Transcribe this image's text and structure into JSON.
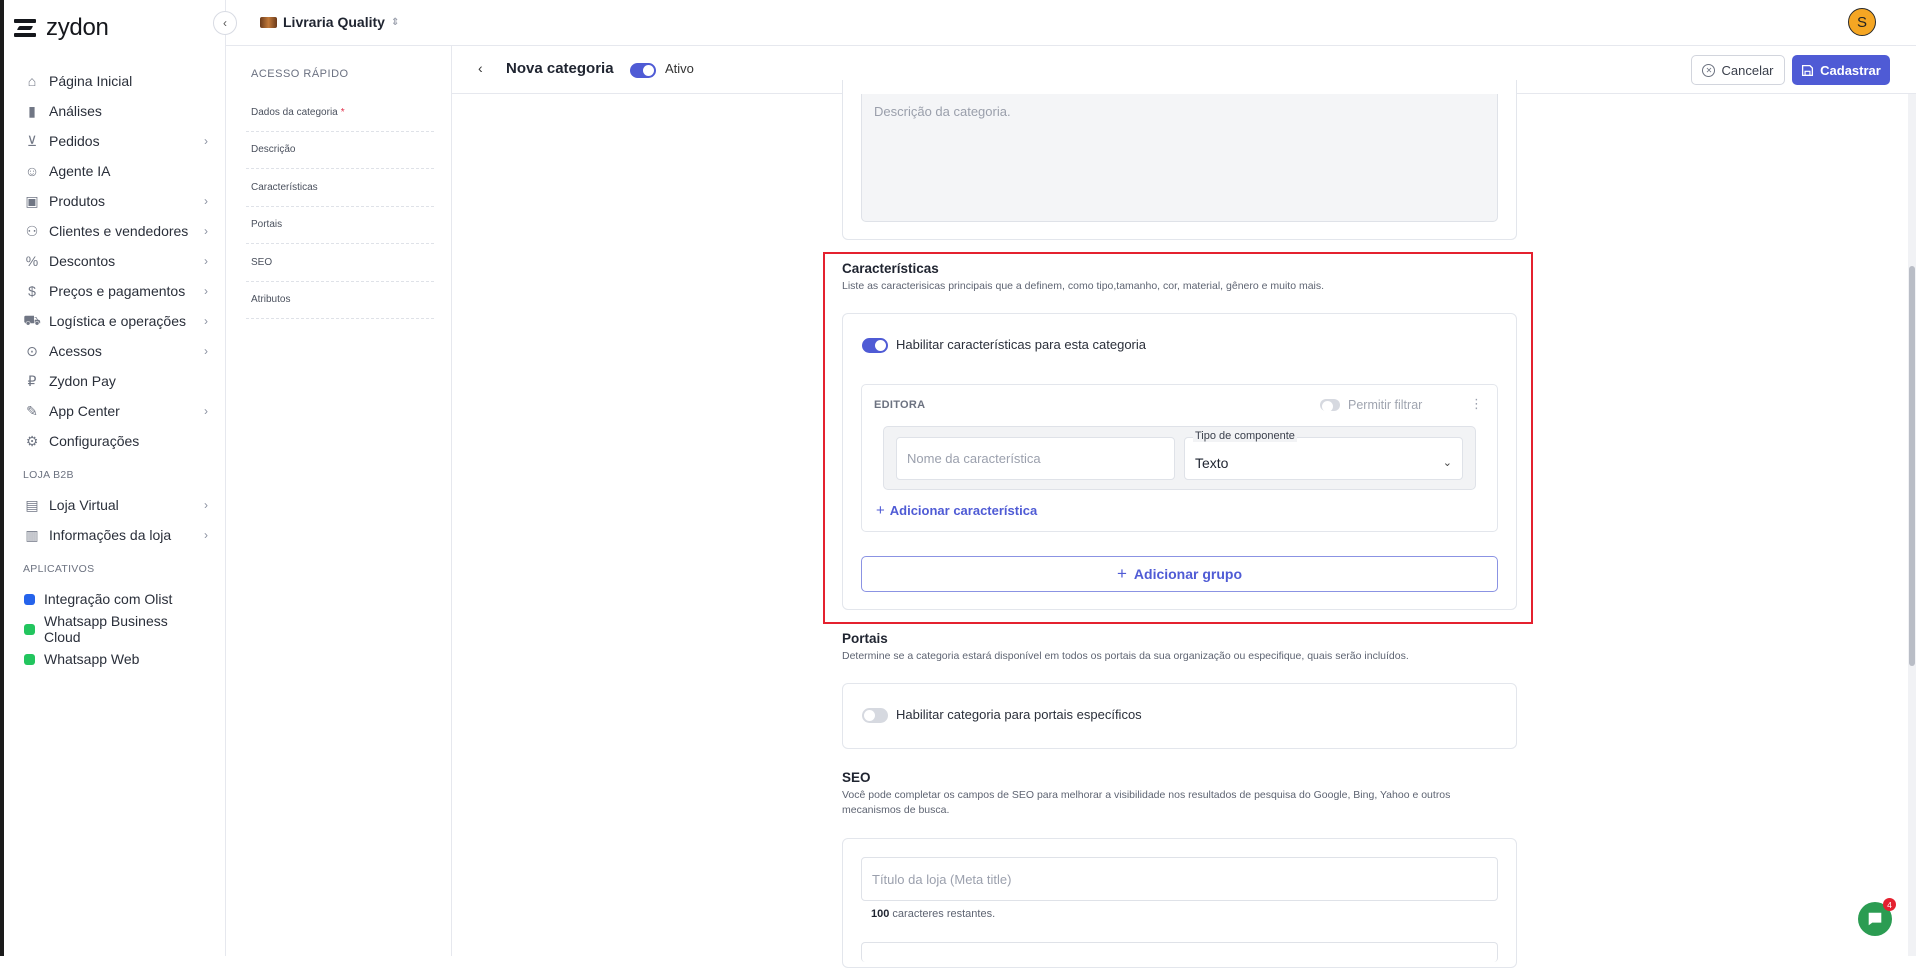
{
  "app": {
    "name": "zydon",
    "store_name": "Livraria Quality",
    "avatar_initial": "S"
  },
  "sidebar": {
    "items": [
      {
        "label": "Página Inicial",
        "icon": "home-icon"
      },
      {
        "label": "Análises",
        "icon": "bar-chart-icon"
      },
      {
        "label": "Pedidos",
        "icon": "cart-icon",
        "chevron": "›"
      },
      {
        "label": "Agente IA",
        "icon": "robot-icon"
      },
      {
        "label": "Produtos",
        "icon": "box-icon",
        "chevron": "›"
      },
      {
        "label": "Clientes e vendedores",
        "icon": "users-icon",
        "chevron": "›"
      },
      {
        "label": "Descontos",
        "icon": "percent-icon",
        "chevron": "›"
      },
      {
        "label": "Preços e pagamentos",
        "icon": "dollar-icon",
        "chevron": "›"
      },
      {
        "label": "Logística e operações",
        "icon": "truck-icon",
        "chevron": "›"
      },
      {
        "label": "Acessos",
        "icon": "lock-icon",
        "chevron": "›"
      },
      {
        "label": "Zydon Pay",
        "icon": "pay-icon"
      },
      {
        "label": "App Center",
        "icon": "puzzle-icon",
        "chevron": "›"
      },
      {
        "label": "Configurações",
        "icon": "gear-icon"
      }
    ],
    "section_b2b": "LOJA B2B",
    "b2b_items": [
      {
        "label": "Loja Virtual",
        "icon": "store-icon",
        "chevron": "›"
      },
      {
        "label": "Informações da loja",
        "icon": "info-card-icon",
        "chevron": "›"
      }
    ],
    "section_apps": "APLICATIVOS",
    "apps": [
      {
        "label": "Integração com Olist",
        "color": "#2563eb"
      },
      {
        "label": "Whatsapp Business Cloud",
        "color": "#22c55e"
      },
      {
        "label": "Whatsapp Web",
        "color": "#22c55e"
      }
    ]
  },
  "quick_access": {
    "title": "ACESSO RÁPIDO",
    "items": [
      {
        "label": "Dados da categoria",
        "required": "*"
      },
      {
        "label": "Descrição",
        "required": ""
      },
      {
        "label": "Características",
        "required": ""
      },
      {
        "label": "Portais",
        "required": ""
      },
      {
        "label": "SEO",
        "required": ""
      },
      {
        "label": "Atributos",
        "required": ""
      }
    ]
  },
  "header": {
    "back": "‹",
    "title": "Nova categoria",
    "status_label": "Ativo",
    "cancel_label": "Cancelar",
    "save_label": "Cadastrar"
  },
  "description": {
    "placeholder": "Descrição da categoria."
  },
  "characteristics": {
    "title": "Características",
    "subtitle": "Liste as caracterisicas principais que a definem, como tipo,tamanho, cor, material, gênero e muito mais.",
    "enable_label": "Habilitar características para esta categoria",
    "group_name": "EDITORA",
    "filter_label": "Permitir filtrar",
    "name_placeholder": "Nome da característica",
    "component_type_label": "Tipo de componente",
    "component_type_value": "Texto",
    "add_characteristic": "Adicionar característica",
    "add_group": "Adicionar grupo"
  },
  "portals": {
    "title": "Portais",
    "subtitle": "Determine se a categoria estará disponível em todos os portais da sua organização ou especifique, quais serão incluídos.",
    "enable_label": "Habilitar categoria para portais específicos"
  },
  "seo": {
    "title": "SEO",
    "subtitle_1": "Você pode completar os campos de SEO para melhorar a visibilidade nos resultados de pesquisa do Google, Bing, Yahoo e outros",
    "subtitle_2": "mecanismos de busca.",
    "meta_title_placeholder": "Título da loja (Meta title)",
    "chars_count": "100",
    "chars_label": "caracteres restantes."
  },
  "chat": {
    "badge": "4"
  },
  "colors": {
    "accent": "#4f5bd5",
    "highlight": "#e4212f"
  }
}
